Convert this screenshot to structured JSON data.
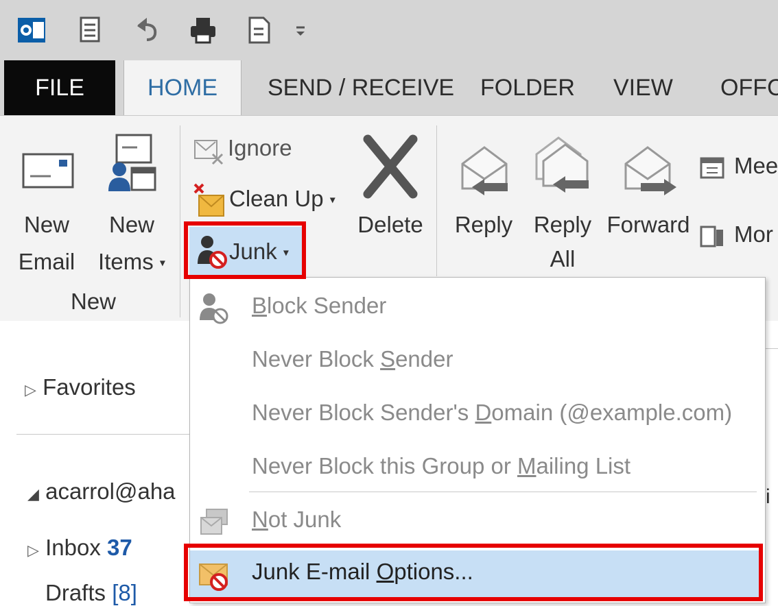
{
  "tabs": {
    "file": "FILE",
    "home": "HOME",
    "send_receive": "SEND / RECEIVE",
    "folder": "FOLDER",
    "view": "VIEW",
    "office": "OFFC"
  },
  "ribbon": {
    "new_email_line1": "New",
    "new_email_line2": "Email",
    "new_items_line1": "New",
    "new_items_line2": "Items",
    "group_new": "New",
    "ignore": "Ignore",
    "clean_up": "Clean Up",
    "junk": "Junk",
    "delete": "Delete",
    "reply": "Reply",
    "reply_all_line1": "Reply",
    "reply_all_line2": "All",
    "forward": "Forward",
    "meeting": "Mee",
    "more": "Mor"
  },
  "nav": {
    "favorites": "Favorites",
    "account": "acarrol@aha",
    "inbox": "Inbox",
    "inbox_count": "37",
    "drafts": "Drafts",
    "drafts_count": "[8]"
  },
  "junk_menu": {
    "block_sender": {
      "pre": "",
      "key": "B",
      "post": "lock Sender"
    },
    "never_block_sender": {
      "pre": "Never Block ",
      "key": "S",
      "post": "ender"
    },
    "never_block_domain": {
      "pre": "Never Block Sender's ",
      "key": "D",
      "post": "omain (@example.com)"
    },
    "never_block_group": {
      "pre": "Never Block this Group or ",
      "key": "M",
      "post": "ailing List"
    },
    "not_junk": {
      "pre": "",
      "key": "N",
      "post": "ot Junk"
    },
    "junk_options": {
      "pre": "Junk E-mail ",
      "key": "O",
      "post": "ptions..."
    }
  },
  "colors": {
    "highlight": "#c7dff5",
    "junk_button_bg": "#c7dff5",
    "red_annotation": "#e60000",
    "tab_active_text": "#2e6da4",
    "count_blue": "#1e5aa8"
  }
}
